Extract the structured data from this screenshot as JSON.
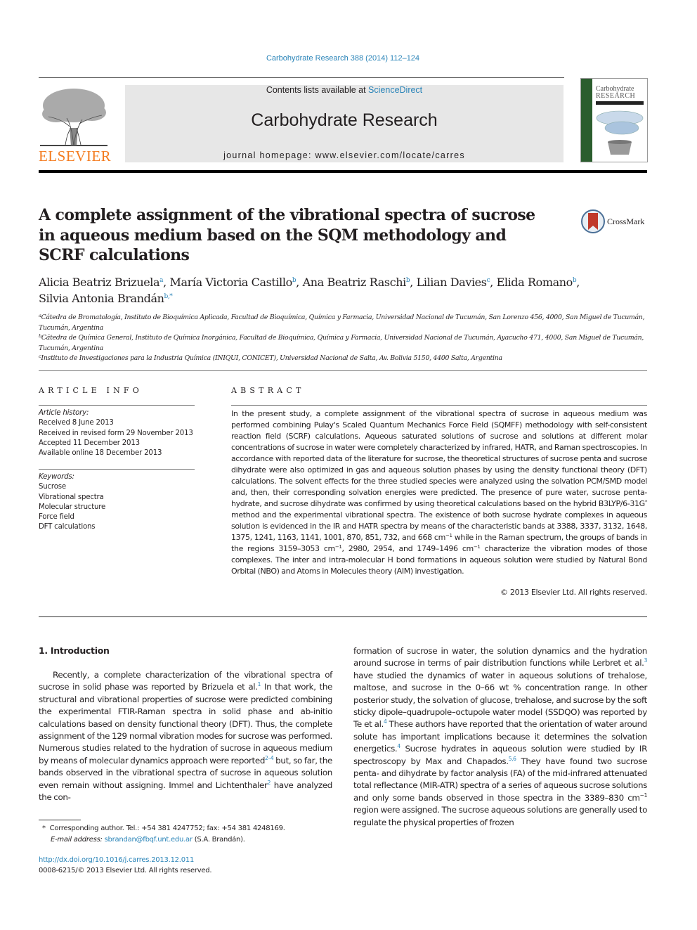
{
  "header": {
    "citation": "Carbohydrate Research 388 (2014) 112–124",
    "contents_prefix": "Contents lists available at ",
    "contents_link": "ScienceDirect",
    "journal_name": "Carbohydrate Research",
    "homepage_prefix": "journal homepage: ",
    "homepage_url": "www.elsevier.com/locate/carres",
    "publisher_logo_text": "ELSEVIER",
    "cover_title_line1": "Carbohydrate",
    "cover_title_line2": "RESEARCH",
    "crossmark_label": "CrossMark"
  },
  "article": {
    "title": "A complete assignment of the vibrational spectra of sucrose in aqueous medium based on the SQM methodology and SCRF calculations",
    "authors": [
      {
        "name": "Alicia Beatriz Brizuela",
        "sup": "a",
        "sep": ", "
      },
      {
        "name": "María Victoria Castillo",
        "sup": "b",
        "sep": ", "
      },
      {
        "name": "Ana Beatriz Raschi",
        "sup": "b",
        "sep": ", "
      },
      {
        "name": "Lilian Davies",
        "sup": "c",
        "sep": ", "
      },
      {
        "name": "Elida Romano",
        "sup": "b",
        "sep": ","
      },
      {
        "name": "Silvia Antonia Brandán",
        "sup": "b,*",
        "sep": ""
      }
    ],
    "affiliations": [
      {
        "key": "a",
        "text": "Cátedra de Bromatología, Instituto de Bioquímica Aplicada, Facultad de Bioquímica, Química y Farmacia, Universidad Nacional de Tucumán, San Lorenzo 456, 4000, San Miguel de Tucumán, Tucumán, Argentina"
      },
      {
        "key": "b",
        "text": "Cátedra de Química General, Instituto de Química Inorgánica, Facultad de Bioquímica, Química y Farmacia, Universidad Nacional de Tucumán, Ayacucho 471, 4000, San Miguel de Tucumán, Tucumán, Argentina"
      },
      {
        "key": "c",
        "text": "Instituto de Investigaciones para la Industria Química (INIQUI, CONICET), Universidad Nacional de Salta, Av. Bolivia 5150, 4400 Salta, Argentina"
      }
    ]
  },
  "article_info": {
    "heading": "ARTICLE INFO",
    "history_label": "Article history:",
    "history": [
      "Received 8 June 2013",
      "Received in revised form 29 November 2013",
      "Accepted 11 December 2013",
      "Available online 18 December 2013"
    ],
    "keywords_label": "Keywords:",
    "keywords": [
      "Sucrose",
      "Vibrational spectra",
      "Molecular structure",
      "Force field",
      "DFT calculations"
    ]
  },
  "abstract": {
    "heading": "ABSTRACT",
    "part1": "In the present study, a complete assignment of the vibrational spectra of sucrose in aqueous medium was performed combining Pulay's Scaled Quantum Mechanics Force Field (SQMFF) methodology with self-consistent reaction field (SCRF) calculations. Aqueous saturated solutions of sucrose and solutions at different molar concentrations of sucrose in water were completely characterized by infrared, HATR, and Raman spectroscopies. In accordance with reported data of the literature for sucrose, the theoretical structures of sucrose penta and sucrose dihydrate were also optimized in gas and aqueous solution phases by using the density functional theory (DFT) calculations. The solvent effects for the three studied species were analyzed using the solvation PCM/SMD model and, then, their corresponding solvation energies were predicted. The presence of pure water, sucrose penta-hydrate, and sucrose dihydrate was confirmed by using theoretical calculations based on the hybrid B3LYP/6-31G",
    "sup1": "*",
    "part2": " method and the experimental vibrational spectra. The existence of both sucrose hydrate complexes in aqueous solution is evidenced in the IR and HATR spectra by means of the characteristic bands at 3388, 3337, 3132, 1648, 1375, 1241, 1163, 1141, 1001, 870, 851, 732, and 668 cm",
    "sup2": "−1",
    "part3": " while in the Raman spectrum, the groups of bands in the regions 3159–3053 cm",
    "sup3": "−1",
    "part4": ", 2980, 2954, and 1749–1496 cm",
    "sup4": "−1",
    "part5": " characterize the vibration modes of those complexes. The inter and intra-molecular H bond formations in aqueous solution were studied by Natural Bond Orbital (NBO) and Atoms in Molecules theory (AIM) investigation.",
    "copyright": "© 2013 Elsevier Ltd. All rights reserved."
  },
  "introduction": {
    "heading": "1. Introduction",
    "left": {
      "t1": "Recently, a complete characterization of the vibrational spectra of sucrose in solid phase was reported by Brizuela et al.",
      "r1": "1",
      "t2": " In that work, the structural and vibrational properties of sucrose were predicted combining the experimental FTIR-Raman spectra in solid phase and ab-initio calculations based on density functional theory (DFT). Thus, the complete assignment of the 129 normal vibration modes for sucrose was performed. Numerous studies related to the hydration of sucrose in aqueous medium by means of molecular dynamics approach were reported",
      "r2": "2–4",
      "t3": " but, so far, the bands observed in the vibrational spectra of sucrose in aqueous solution even remain without assigning. Immel and Lichtenthaler",
      "r3": "2",
      "t4": " have analyzed the con-"
    },
    "right": {
      "t1": "formation of sucrose in water, the solution dynamics and the hydration around sucrose in terms of pair distribution functions while Lerbret et al.",
      "r1": "3",
      "t2": " have studied the dynamics of water in aqueous solutions of trehalose, maltose, and sucrose in the 0–66 wt % concentration range. In other posterior study, the solvation of glucose, trehalose, and sucrose by the soft sticky dipole–quadrupole–octupole water model (SSDQO) was reported by Te et al.",
      "r2": "4",
      "t3": " These authors have reported that the orientation of water around solute has important implications because it determines the solvation energetics.",
      "r3": "4",
      "t4": " Sucrose hydrates in aqueous solution were studied by IR spectroscopy by Max and Chapados.",
      "r4": "5,6",
      "t5": " They have found two sucrose penta- and dihydrate by factor analysis (FA) of the mid-infrared attenuated total reflectance (MIR-ATR) spectra of a series of aqueous sucrose solutions and only some bands observed in those spectra in the 3389–830 cm",
      "s1": "−1",
      "t6": " region were assigned. The sucrose aqueous solutions are generally used to regulate the physical properties of frozen"
    }
  },
  "footnotes": {
    "marker": "*",
    "corresponding": "Corresponding author. Tel.: +54 381 4247752; fax: +54 381 4248169.",
    "email_label": "E-mail address: ",
    "email": "sbrandan@fbqf.unt.edu.ar",
    "email_suffix": " (S.A. Brandán).",
    "doi": "http://dx.doi.org/10.1016/j.carres.2013.12.011",
    "issn": "0008-6215/© 2013 Elsevier Ltd. All rights reserved."
  },
  "colors": {
    "link": "#2a84b8",
    "elsevier_orange": "#f47c20",
    "masthead_bg": "#e7e7e7",
    "cover_band": "#2b5d2e",
    "crossmark_red": "#c0392b"
  }
}
